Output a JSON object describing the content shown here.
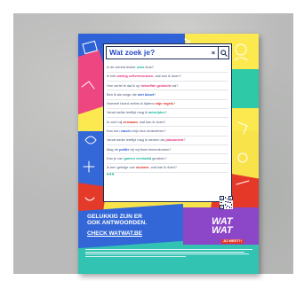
{
  "search": {
    "query": "Wat zoek je?",
    "clear_symbol": "×"
  },
  "suggestions": [
    {
      "parts": [
        {
          "t": "Is de wereld leuker ",
          "c": ""
        },
        {
          "t": "seks",
          "c": "hl-teal"
        },
        {
          "t": " leuk?",
          "c": ""
        }
      ]
    },
    {
      "parts": [
        {
          "t": "Ik heb ",
          "c": ""
        },
        {
          "t": "weinig zelfvertrouwen",
          "c": "hl-pink"
        },
        {
          "t": ", wat kan ik doen?",
          "c": ""
        }
      ]
    },
    {
      "parts": [
        {
          "t": "Hoe vertel ik dat ik op ",
          "c": ""
        },
        {
          "t": "hetzelfde geslacht",
          "c": "hl-pink"
        },
        {
          "t": " val?",
          "c": ""
        }
      ]
    },
    {
      "parts": [
        {
          "t": "Ben ik als enige die ",
          "c": ""
        },
        {
          "t": "niet blowt",
          "c": "hl-blue"
        },
        {
          "t": "?",
          "c": ""
        }
      ]
    },
    {
      "parts": [
        {
          "t": "Hoeveel bloed verlies ik tijdens ",
          "c": ""
        },
        {
          "t": "mijn regels",
          "c": "hl-red"
        },
        {
          "t": "?",
          "c": ""
        }
      ]
    },
    {
      "parts": [
        {
          "t": "Vanaf welke leeftijd mag ik ",
          "c": ""
        },
        {
          "t": "autorijden",
          "c": "hl-teal"
        },
        {
          "t": "?",
          "c": ""
        }
      ]
    },
    {
      "parts": [
        {
          "t": "Ik voel mij ",
          "c": ""
        },
        {
          "t": "eenzaam",
          "c": "hl-red"
        },
        {
          "t": ", wat kan ik doen?",
          "c": ""
        }
      ]
    },
    {
      "parts": [
        {
          "t": "Kan een ",
          "c": ""
        },
        {
          "t": "vaccin",
          "c": "hl-blue"
        },
        {
          "t": " mijn dna veranderen?",
          "c": ""
        }
      ]
    },
    {
      "parts": [
        {
          "t": "Vanaf welke leeftijd mag ik werken als ",
          "c": ""
        },
        {
          "t": "jobstudent",
          "c": "hl-pink"
        },
        {
          "t": "?",
          "c": ""
        }
      ]
    },
    {
      "parts": [
        {
          "t": "Mag de ",
          "c": ""
        },
        {
          "t": "politie",
          "c": "hl-blue"
        },
        {
          "t": " bij mij thuis binnenkomen?",
          "c": ""
        }
      ]
    },
    {
      "parts": [
        {
          "t": "Kan je van ",
          "c": ""
        },
        {
          "t": "gamen verslaafd",
          "c": "hl-teal"
        },
        {
          "t": " geraken?",
          "c": ""
        }
      ]
    },
    {
      "parts": [
        {
          "t": "Ik ben getuige van ",
          "c": ""
        },
        {
          "t": "racisme",
          "c": "hl-red"
        },
        {
          "t": ", wat kan ik doen?",
          "c": ""
        }
      ]
    }
  ],
  "more_indicator": "•••",
  "tagline": {
    "line1": "GELUKKIG ZIJN ER",
    "line2": "OOK ANTWOORDEN."
  },
  "cta": "CHECK WATWAT.BE",
  "logo": {
    "word1": "WAT",
    "word2": "WAT",
    "sub": "JIJ WEET?!"
  },
  "colors": {
    "yellow": "#fbe94f",
    "blue": "#3367d8",
    "teal": "#33c3b3",
    "red": "#e53829",
    "pink": "#ee4680",
    "purple": "#8c46c8",
    "navy": "#1c2a55"
  },
  "icons": [
    "search-icon",
    "close-icon",
    "qr-code",
    "doodle-icons"
  ]
}
